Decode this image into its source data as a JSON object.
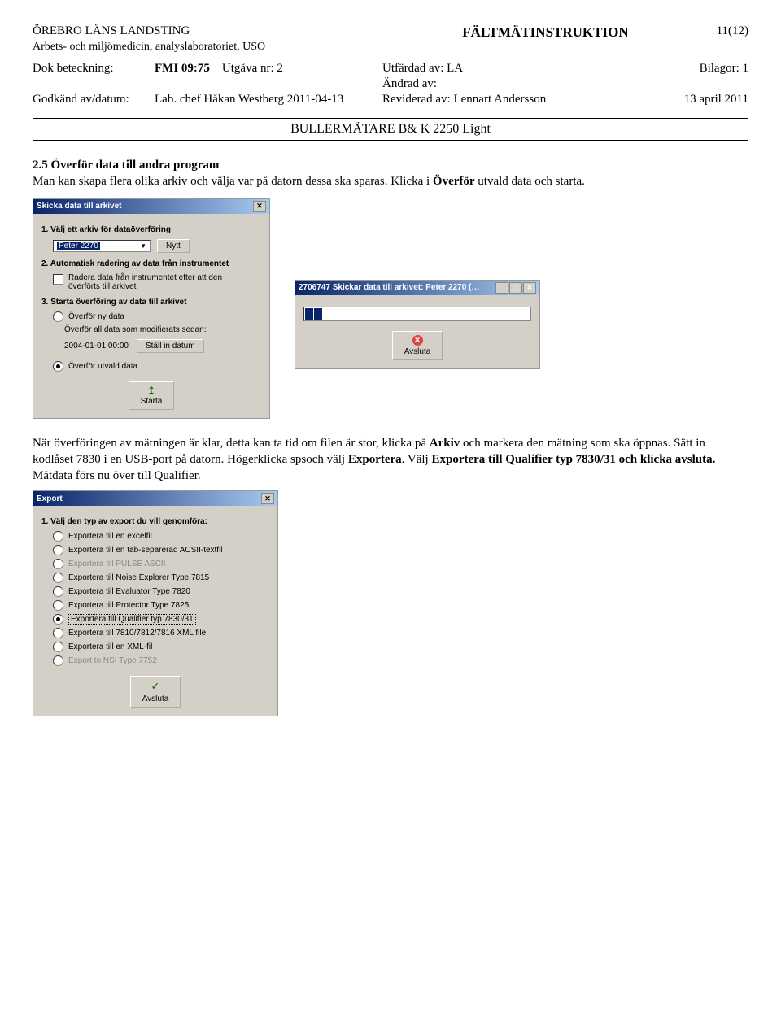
{
  "header": {
    "org": "ÖREBRO LÄNS LANDSTING",
    "suborg": "Arbets- och miljömedicin, analyslaboratoriet, USÖ",
    "doctype": "FÄLTMÄTINSTRUKTION",
    "page": "11(12)"
  },
  "info": {
    "dokbet_label": "Dok beteckning:",
    "dokbet_value": "FMI 09:75",
    "utgava_label": "Utgåva nr: 2",
    "utfardad": "Utfärdad av: LA",
    "bilagor": "Bilagor: 1",
    "andrad": "Ändrad av:",
    "godkand_label": "Godkänd av/datum:",
    "godkand_value": "Lab. chef  Håkan Westberg 2011-04-13",
    "reviderad": "Reviderad av: Lennart Andersson",
    "revdate": "13 april 2011"
  },
  "title": "BULLERMÄTARE B& K 2250 Light",
  "section": {
    "heading": "2.5 Överför data till andra program",
    "para1_a": "Man kan skapa flera olika arkiv och välja var på datorn dessa ska sparas. Klicka i ",
    "para1_b": "Överför",
    "para1_c": " utvald data och starta.",
    "para2_a": "När överföringen av mätningen är klar, detta kan ta tid om filen är stor, klicka på ",
    "para2_b": "Arkiv",
    "para2_c": " och markera den mätning som ska öppnas. Sätt in kodlåset 7830 i en USB-port på datorn. Högerklicka spsoch välj ",
    "para2_d": "Exportera",
    "para2_e": ". Välj ",
    "para2_f": "Exportera till Qualifier typ 7830/31 och klicka avsluta.",
    "para2_g": " Mätdata förs nu över till Qualifier."
  },
  "dlg1": {
    "title": "Skicka data till arkivet",
    "step1": "1.  Välj ett arkiv för dataöverföring",
    "archive": "Peter 2270",
    "nytt": "Nytt",
    "step2": "2.  Automatisk radering av data från instrumentet",
    "erase": "Radera data från instrumentet efter att den\növerförts till arkivet",
    "step3": "3.  Starta överföring av data till arkivet",
    "r1": "Överför ny data",
    "r2": "Överför all data som modifierats sedan:",
    "date": "2004-01-01 00:00",
    "setdate": "Ställ in datum",
    "r3": "Överför utvald data",
    "start": "Starta"
  },
  "dlg2": {
    "title": "2706747 Skickar data till arkivet: Peter 2270 (…",
    "close": "Avsluta"
  },
  "dlg3": {
    "title": "Export",
    "step": "1.  Välj den typ av export du vill genomföra:",
    "o1": "Exportera till en excelfil",
    "o2": "Exportera till en tab-separerad ACSII-textfil",
    "o3": "Exportera till PULSE ASCII",
    "o4": "Exportera till Noise Explorer Type 7815",
    "o5": "Exportera till Evaluator Type 7820",
    "o6": "Exportera till Protector Type 7825",
    "o7": "Exportera till Qualifier typ 7830/31",
    "o8": "Exportera till 7810/7812/7816 XML file",
    "o9": "Exportera till en XML-fil",
    "o10": "Export to NSI Type 7752",
    "close": "Avsluta"
  }
}
